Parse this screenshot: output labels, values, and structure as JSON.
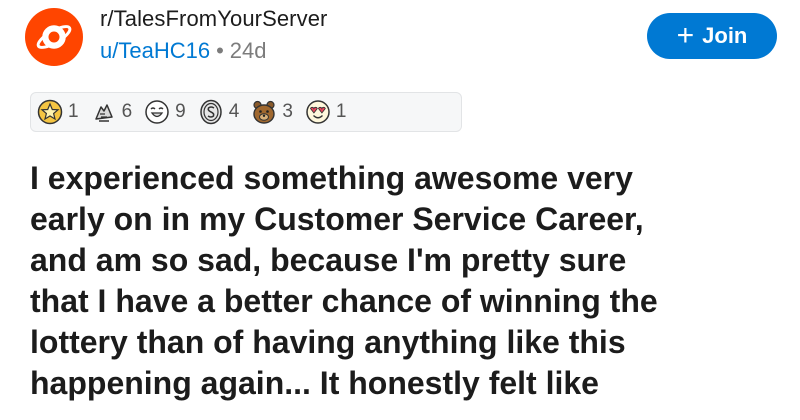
{
  "header": {
    "subreddit": "r/TalesFromYourServer",
    "username": "u/TeaHC16",
    "separator": "•",
    "age": "24d",
    "join_label": "Join",
    "join_plus": "+",
    "accent_color": "#0079d3",
    "avatar_color": "#ff4500",
    "avatar_icon": "planet-icon"
  },
  "awards": [
    {
      "icon": "gold-star-award-icon",
      "count": "1"
    },
    {
      "icon": "hands-award-icon",
      "count": "6"
    },
    {
      "icon": "laughing-face-award-icon",
      "count": "9"
    },
    {
      "icon": "silver-coin-award-icon",
      "count": "4"
    },
    {
      "icon": "bear-award-icon",
      "count": "3"
    },
    {
      "icon": "heart-eyes-award-icon",
      "count": "1"
    }
  ],
  "post": {
    "lines": [
      "I experienced something awesome very",
      "early on in my Customer Service Career,",
      "and am so sad, because I'm pretty sure",
      "that I have a better chance of winning the",
      "lottery than of having anything like this",
      "happening again... It honestly felt like"
    ]
  }
}
